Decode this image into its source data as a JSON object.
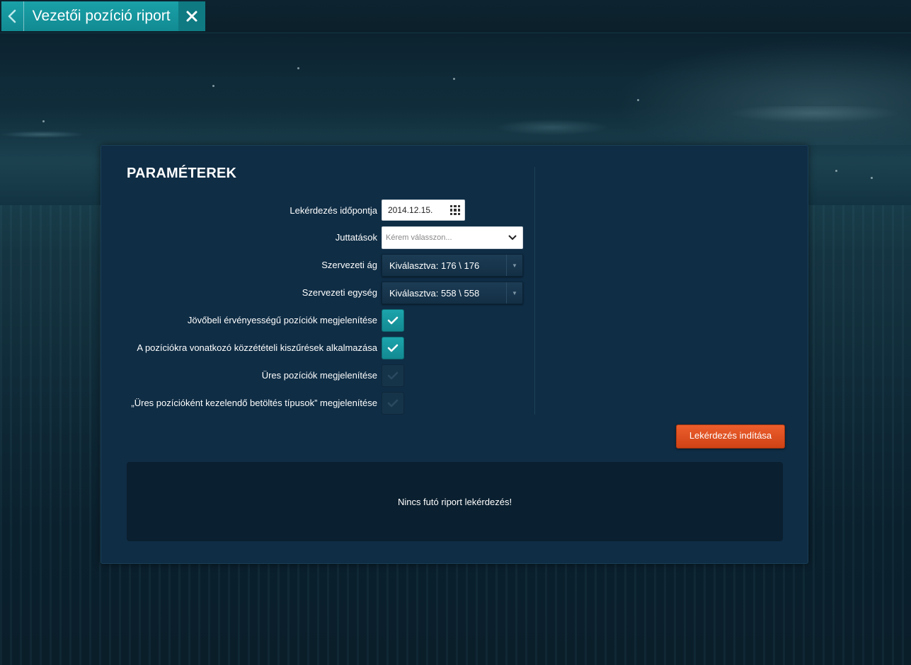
{
  "tab": {
    "title": "Vezetői pozíció riport",
    "back_icon": "chevron-left-icon",
    "close_icon": "close-icon"
  },
  "panel": {
    "heading": "PARAMÉTEREK",
    "fields": {
      "date": {
        "label": "Lekérdezés időpontja",
        "value": "2014.12.15."
      },
      "benefits": {
        "label": "Juttatások",
        "placeholder": "Kérem válasszon..."
      },
      "branch": {
        "label": "Szervezeti ág",
        "value": "Kiválasztva: 176 \\ 176"
      },
      "unit": {
        "label": "Szervezeti egység",
        "value": "Kiválasztva: 558 \\ 558"
      }
    },
    "checkboxes": [
      {
        "label": "Jövőbeli érvényességű pozíciók megjelenítése",
        "checked": true
      },
      {
        "label": "A pozíciókra vonatkozó közzétételi kiszűrések alkalmazása",
        "checked": true
      },
      {
        "label": "Üres pozíciók megjelenítése",
        "checked": false
      },
      {
        "label": "„Üres pozícióként kezelendő betöltés típusok” megjelenítése",
        "checked": false
      }
    ],
    "run_button": "Lekérdezés indítása",
    "status_text": "Nincs futó riport lekérdezés!"
  },
  "colors": {
    "accent": "#1aa1a8",
    "primary_action": "#e05324",
    "panel_bg": "#0f2d45"
  }
}
